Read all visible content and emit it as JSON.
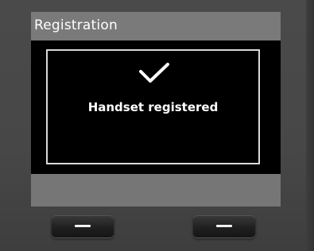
{
  "screen": {
    "title": "Registration",
    "message": "Handset registered",
    "status_icon": "check-icon"
  },
  "softkeys": {
    "left_icon": "dash-icon",
    "right_icon": "dash-icon"
  },
  "colors": {
    "body": "#4a4a4a",
    "screen_frame": "#767676",
    "message_background": "#000000",
    "text": "#ffffff"
  }
}
